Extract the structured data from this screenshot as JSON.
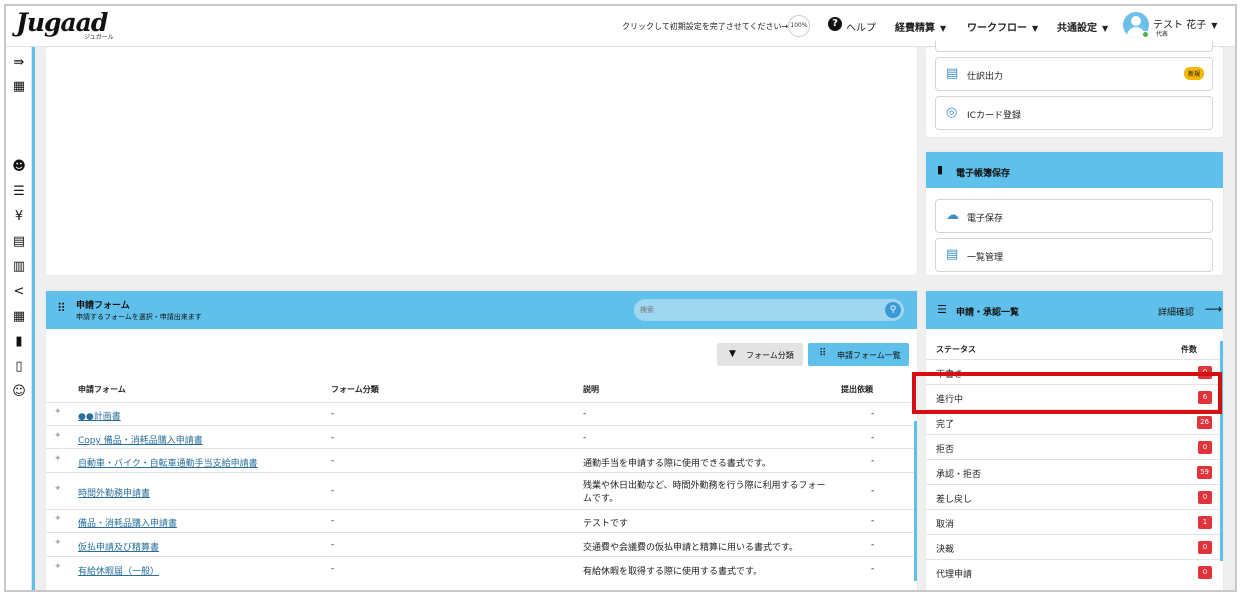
{
  "header": {
    "logo": "Jugaad",
    "logo_sub": "ジュガール",
    "setup_prompt": "クリックして初期設定を完了させてください→",
    "setup_percent": "100%",
    "help": "ヘルプ",
    "nav": [
      "経費精算",
      "ワークフロー",
      "共通設定"
    ],
    "user_name": "テスト 花子",
    "user_role": "代表"
  },
  "sidebar_icons": [
    "expand-icon",
    "building-icon",
    "users-icon",
    "list-icon",
    "yen-icon",
    "document-icon",
    "ledger-icon",
    "share-icon",
    "grid-icon",
    "invoice-icon",
    "book-icon",
    "support-icon"
  ],
  "right_top": {
    "items": [
      {
        "label": "仕訳出力",
        "badge": "新規",
        "icon": "export-icon"
      },
      {
        "label": "ICカード登録",
        "icon": "globe-icon"
      }
    ]
  },
  "ebook": {
    "title": "電子帳簿保存",
    "items": [
      {
        "label": "電子保存",
        "icon": "cloud-upload-icon"
      },
      {
        "label": "一覧管理",
        "icon": "list-doc-icon"
      }
    ]
  },
  "forms": {
    "title": "申請フォーム",
    "subtitle": "申請するフォームを選択・申請出来ます",
    "search_placeholder": "検索",
    "filter_button": "フォーム分類",
    "list_button": "申請フォーム一覧",
    "columns": [
      "申請フォーム",
      "フォーム分類",
      "説明",
      "提出依頼"
    ],
    "rows": [
      {
        "name": "●●計画書",
        "category": "-",
        "desc": "-",
        "request": "-"
      },
      {
        "name": "Copy 備品・消耗品購入申請書",
        "category": "-",
        "desc": "-",
        "request": "-"
      },
      {
        "name": "自動車・バイク・自転車通勤手当支給申請書",
        "category": "-",
        "desc": "通勤手当を申請する際に使用できる書式です。",
        "request": "-"
      },
      {
        "name": "時間外勤務申請書",
        "category": "-",
        "desc": "残業や休日出勤など、時間外勤務を行う際に利用するフォー",
        "desc2": "ムです。",
        "request": "-"
      },
      {
        "name": "備品・消耗品購入申請書",
        "category": "-",
        "desc": "テストです",
        "request": "-"
      },
      {
        "name": "仮払申請及び精算書",
        "category": "-",
        "desc": "交通費や会議費の仮払申請と精算に用いる書式です。",
        "request": "-"
      },
      {
        "name": "有給休暇届（一般）",
        "category": "-",
        "desc": "有給休暇を取得する際に使用する書式です。",
        "request": "-"
      }
    ]
  },
  "approvals": {
    "title": "申請・承認一覧",
    "detail_link": "詳細確認",
    "col_status": "ステータス",
    "col_count": "件数",
    "rows": [
      {
        "label": "下書き",
        "count": "0"
      },
      {
        "label": "進行中",
        "count": "6"
      },
      {
        "label": "完了",
        "count": "26"
      },
      {
        "label": "拒否",
        "count": "0"
      },
      {
        "label": "承認・拒否",
        "count": "59"
      },
      {
        "label": "差し戻し",
        "count": "0"
      },
      {
        "label": "取消",
        "count": "1"
      },
      {
        "label": "決裁",
        "count": "0"
      },
      {
        "label": "代理申請",
        "count": "0"
      }
    ]
  },
  "colors": {
    "accent": "#5fc0eb",
    "badge_red": "#e0343a",
    "highlight": "#d40f0f",
    "new_badge": "#f5b800"
  }
}
